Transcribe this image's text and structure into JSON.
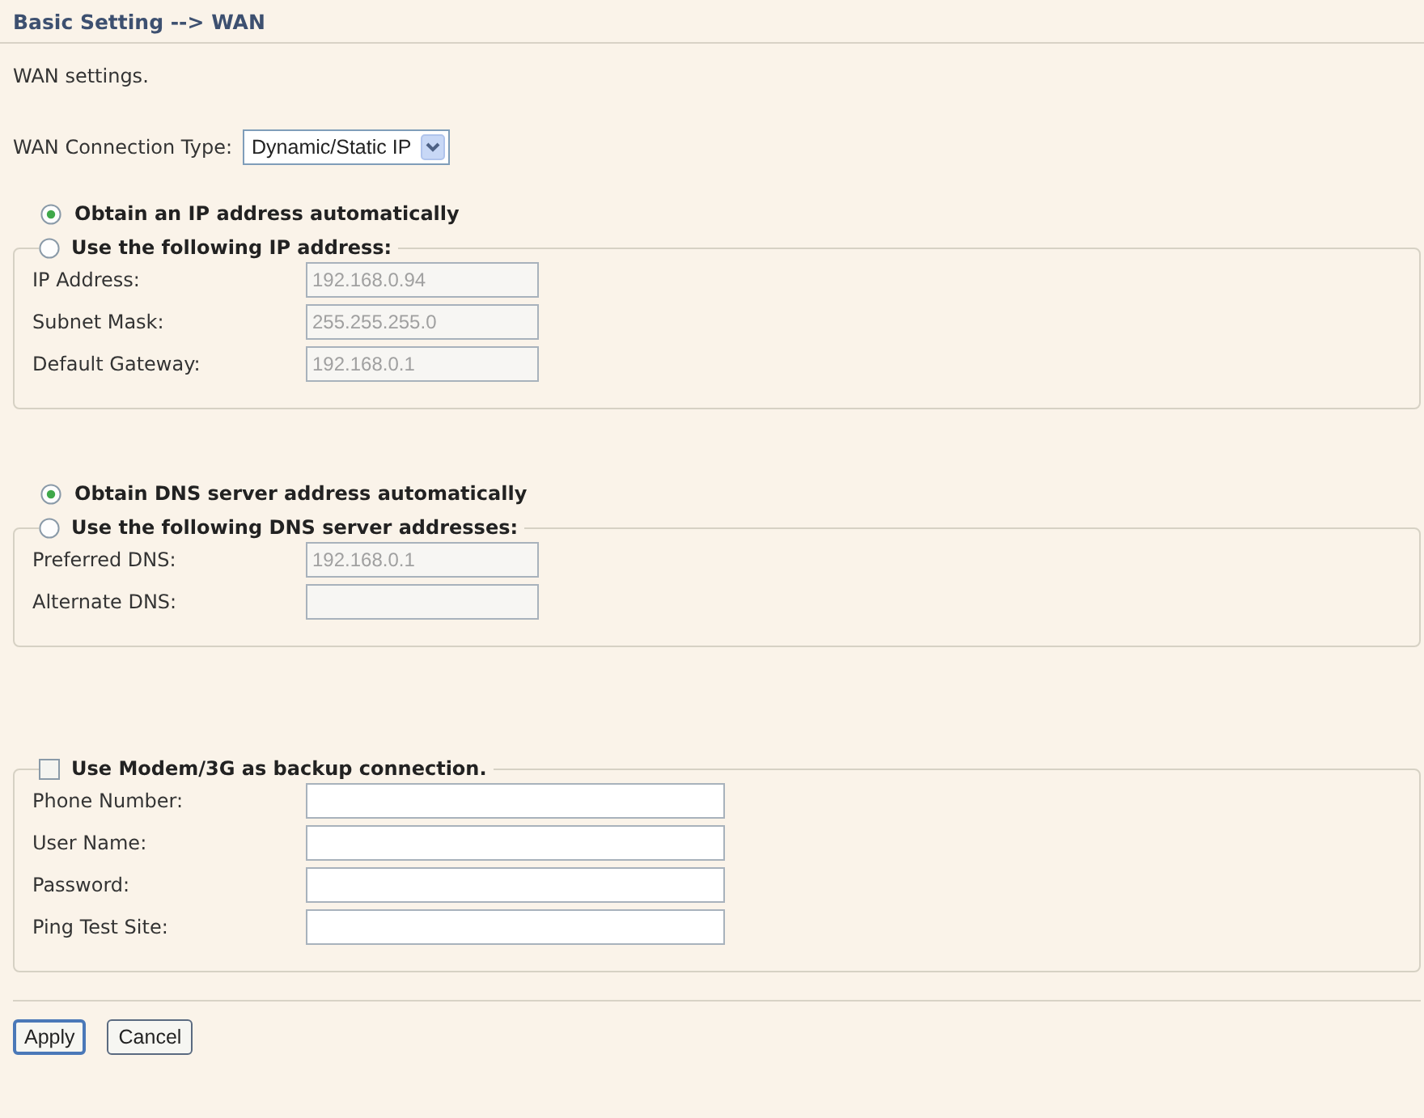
{
  "header": {
    "title": "Basic Setting --> WAN"
  },
  "intro": "WAN settings.",
  "connection_type": {
    "label": "WAN Connection Type:",
    "value": "Dynamic/Static IP"
  },
  "groups": [
    {
      "auto_option": {
        "label": "Obtain an IP address automatically",
        "selected": true
      },
      "legend": {
        "kind": "radio",
        "label": "Use the following IP address:",
        "selected": false
      },
      "fields": [
        {
          "label": "IP Address:",
          "value": "192.168.0.94",
          "disabled": true
        },
        {
          "label": "Subnet Mask:",
          "value": "255.255.255.0",
          "disabled": true
        },
        {
          "label": "Default Gateway:",
          "value": "192.168.0.1",
          "disabled": true
        }
      ]
    },
    {
      "auto_option": {
        "label": "Obtain DNS server address automatically",
        "selected": true
      },
      "legend": {
        "kind": "radio",
        "label": "Use the following DNS server addresses:",
        "selected": false
      },
      "fields": [
        {
          "label": "Preferred DNS:",
          "value": "192.168.0.1",
          "disabled": true
        },
        {
          "label": "Alternate DNS:",
          "disabled": true
        }
      ]
    },
    {
      "legend": {
        "kind": "checkbox",
        "label": "Use Modem/3G as backup connection.",
        "checked": false
      },
      "fields": [
        {
          "label": "Phone Number:",
          "disabled": false
        },
        {
          "label": "User Name:",
          "disabled": false
        },
        {
          "label": "Password:",
          "disabled": false
        },
        {
          "label": "Ping Test Site:",
          "disabled": false
        }
      ]
    }
  ],
  "buttons": [
    {
      "label": "Apply",
      "default": true
    },
    {
      "label": "Cancel",
      "default": false
    }
  ]
}
